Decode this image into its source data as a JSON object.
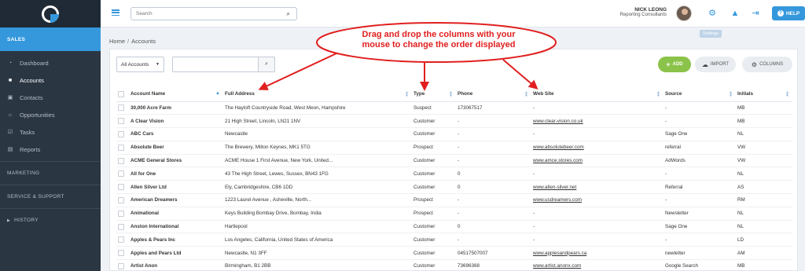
{
  "sidebar": {
    "section_sales": "SALES",
    "items": [
      {
        "label": "Dashboard",
        "icon": "dashboard-icon"
      },
      {
        "label": "Accounts",
        "icon": "briefcase-icon"
      },
      {
        "label": "Contacts",
        "icon": "contacts-icon"
      },
      {
        "label": "Opportunities",
        "icon": "lightbulb-icon"
      },
      {
        "label": "Tasks",
        "icon": "check-square-icon"
      },
      {
        "label": "Reports",
        "icon": "file-icon"
      }
    ],
    "section_marketing": "MARKETING",
    "section_service": "SERVICE & SUPPORT",
    "section_history": "HISTORY"
  },
  "topbar": {
    "search_placeholder": "Search",
    "user_name": "NICK LEONG",
    "user_role": "Reporting Consultants",
    "settings_tooltip": "Settings",
    "help_label": "HELP"
  },
  "breadcrumb": {
    "home": "Home",
    "current": "Accounts"
  },
  "toolbar": {
    "account_filter": "All Accounts",
    "add_label": "ADD",
    "import_label": "IMPORT",
    "columns_label": "COLUMNS"
  },
  "annotation": {
    "line1": "Drag and drop the columns with your",
    "line2": "mouse to change the order displayed"
  },
  "table": {
    "headers": {
      "name": "Account Name",
      "address": "Full Address",
      "type": "Type",
      "phone": "Phone",
      "web": "Web Site",
      "source": "Source",
      "initials": "Initials"
    },
    "rows": [
      {
        "name": "30,000 Acre Farm",
        "address": "The Hayloft Countryside Road, West Meon, Hampshire",
        "type": "Suspect",
        "phone": "173067517",
        "web": "-",
        "web_link": false,
        "source": "-",
        "initials": "MB"
      },
      {
        "name": "A Clear Vision",
        "address": "21 High Street, Lincoln, LN21 1NV",
        "type": "Customer",
        "phone": "-",
        "web": "www.clear-vision.co.uk",
        "web_link": true,
        "source": "-",
        "initials": "MB"
      },
      {
        "name": "ABC Cars",
        "address": "Newcastle",
        "type": "Customer",
        "phone": "-",
        "web": "-",
        "web_link": false,
        "source": "Sage One",
        "initials": "NL"
      },
      {
        "name": "Absolute Beer",
        "address": "The Brewery, Milton Keynes, MK1 5TG",
        "type": "Prospect",
        "phone": "-",
        "web": "www.absolutebeer.com",
        "web_link": true,
        "source": "referral",
        "initials": "VW"
      },
      {
        "name": "ACME General Stores",
        "address": "ACME House 1 First Avenue, New York, United...",
        "type": "Customer",
        "phone": "-",
        "web": "www.amce.stores.com",
        "web_link": true,
        "source": "AdWords",
        "initials": "VW"
      },
      {
        "name": "All for One",
        "address": "43 The High Street, Lewes, Sussex, BN43 1FG",
        "type": "Customer",
        "phone": "0",
        "web": "-",
        "web_link": false,
        "source": "-",
        "initials": "NL"
      },
      {
        "name": "Allen Silver Ltd",
        "address": "Ely, Cambridgeshire, CB6 1DD",
        "type": "Customer",
        "phone": "0",
        "web": "www.allen-silver.net",
        "web_link": true,
        "source": "Referral",
        "initials": "AS"
      },
      {
        "name": "American Dreamers",
        "address": "1223 Laurel Avenue , Asheville, North...",
        "type": "Prospect",
        "phone": "-",
        "web": "www.usdreamers.com",
        "web_link": true,
        "source": "-",
        "initials": "RM"
      },
      {
        "name": "Animational",
        "address": "Keys Building Bombay Drive, Bombay, India",
        "type": "Prospect",
        "phone": "-",
        "web": "-",
        "web_link": false,
        "source": "Newsletter",
        "initials": "NL"
      },
      {
        "name": "Anston International",
        "address": "Hartlepool",
        "type": "Customer",
        "phone": "0",
        "web": "-",
        "web_link": false,
        "source": "Sage One",
        "initials": "NL"
      },
      {
        "name": "Apples & Pears Inc",
        "address": "Los Angeles, California, United States of America",
        "type": "Customer",
        "phone": "-",
        "web": "-",
        "web_link": false,
        "source": "-",
        "initials": "LD"
      },
      {
        "name": "Apples and Pears Ltd",
        "address": "Newcastle, N1 3FF",
        "type": "Customer",
        "phone": "04517507007",
        "web": "www.applesandpears.ca",
        "web_link": true,
        "source": "newletter",
        "initials": "AM"
      },
      {
        "name": "Artist Anon",
        "address": "Birmingham, B1 2BB",
        "type": "Customer",
        "phone": "73696368",
        "web": "www.artist.anonx.com",
        "web_link": true,
        "source": "Google Search",
        "initials": "MB"
      }
    ]
  },
  "colors": {
    "accent": "#3598dc",
    "sidebar": "#2b3643",
    "add_green": "#8bc34a",
    "annotation_red": "#e11f1f"
  }
}
